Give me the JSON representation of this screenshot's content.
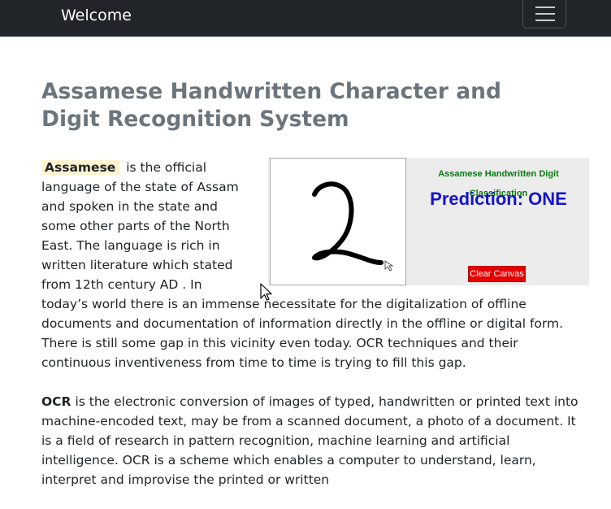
{
  "navbar": {
    "brand": "Welcome"
  },
  "header": {
    "title": "Assamese Handwritten Character and Digit Recognition System"
  },
  "widget": {
    "panel_title": "Assamese Handwritten Digit Classification",
    "prediction": "Prediction: ONE",
    "clear_label": "Clear Canvas"
  },
  "paragraph1": {
    "highlight": "Assamese",
    "text": "is the official language of the state of Assam and spoken in the state and some other parts of the North East. The language is rich in written literature which stated from 12th century AD . In today’s world there is an immense necessitate for the digitalization of offline documents and documentation of information directly in the offline or digital form. There is still some gap in this vicinity even today. OCR techniques and their continuous inventiveness from time to time is trying to fill this gap."
  },
  "paragraph2": {
    "keyword": "OCR",
    "text": "is the electronic conversion of images of typed, handwritten or printed text into machine-encoded text, may be from a scanned document, a photo of a document. It is a field of research in pattern recognition, machine learning and artificial intelligence. OCR is a scheme which enables a computer to understand, learn, interpret and improvise the printed or written"
  }
}
